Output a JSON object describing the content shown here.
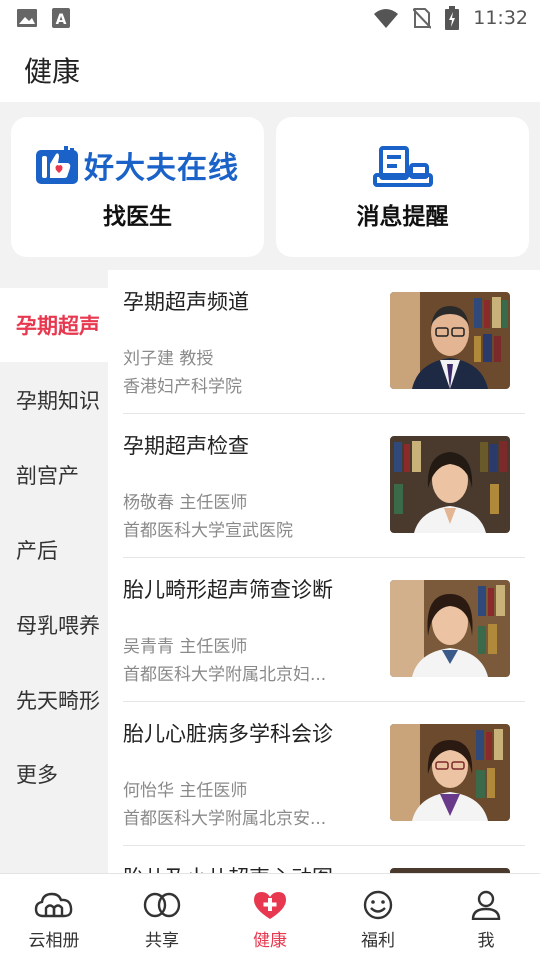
{
  "status_bar": {
    "time": "11:32"
  },
  "header": {
    "title": "健康"
  },
  "cards": {
    "find_doctor": {
      "brand": "好大夫在线",
      "label": "找医生"
    },
    "messages": {
      "label": "消息提醒"
    }
  },
  "side_nav": {
    "items": [
      {
        "label": "孕期超声",
        "active": true
      },
      {
        "label": "孕期知识"
      },
      {
        "label": "剖宫产"
      },
      {
        "label": "产后"
      },
      {
        "label": "母乳喂养"
      },
      {
        "label": "先天畸形"
      },
      {
        "label": "更多"
      }
    ]
  },
  "doctor_list": [
    {
      "title": "孕期超声频道",
      "name": "刘子建 教授",
      "hospital": "香港妇产科学院"
    },
    {
      "title": "孕期超声检查",
      "name": "杨敬春 主任医师",
      "hospital": "首都医科大学宣武医院"
    },
    {
      "title": "胎儿畸形超声筛查诊断",
      "name": "吴青青 主任医师",
      "hospital": "首都医科大学附属北京妇..."
    },
    {
      "title": "胎儿心脏病多学科会诊",
      "name": "何怡华 主任医师",
      "hospital": "首都医科大学附属北京安..."
    },
    {
      "title": "胎儿及小儿超声心动图",
      "name": "",
      "hospital": ""
    }
  ],
  "tab_bar": {
    "tabs": [
      {
        "label": "云相册",
        "icon": "cloud-album-icon"
      },
      {
        "label": "共享",
        "icon": "share-rings-icon"
      },
      {
        "label": "健康",
        "icon": "health-heart-icon",
        "active": true
      },
      {
        "label": "福利",
        "icon": "smiley-icon"
      },
      {
        "label": "我",
        "icon": "person-icon"
      }
    ]
  },
  "colors": {
    "accent": "#e8384f",
    "brand_blue": "#1a62c8",
    "background": "#f2f2f2"
  }
}
